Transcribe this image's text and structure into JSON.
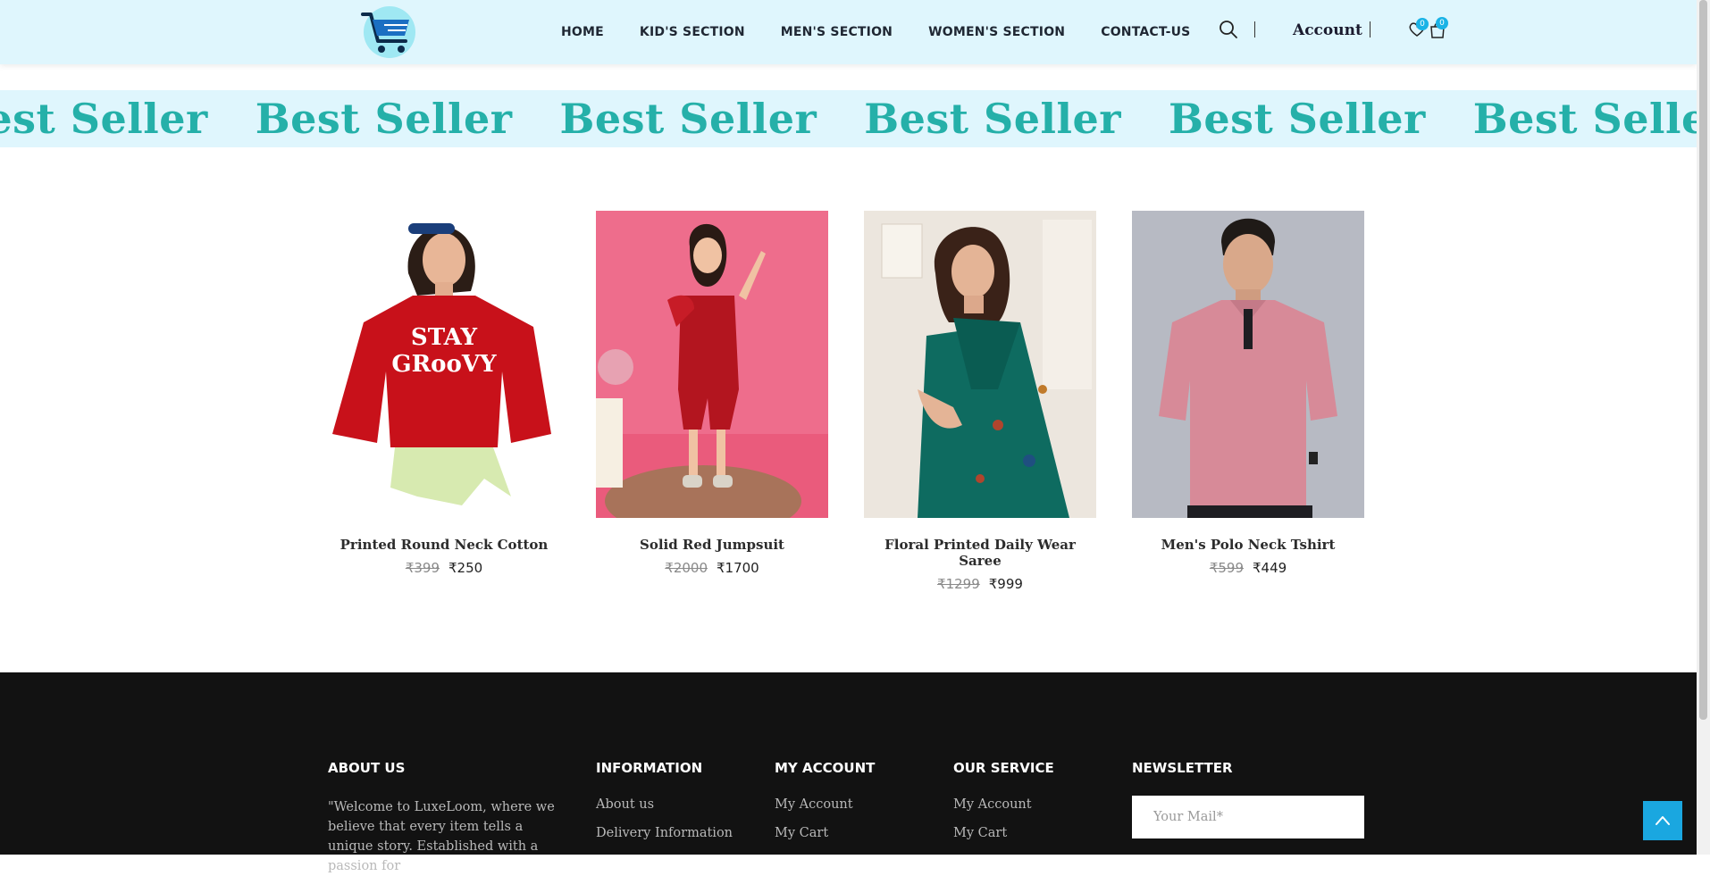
{
  "colors": {
    "header_bg": "#dff6fd",
    "marquee_text": "#25b0a9",
    "badge": "#1ab3e6",
    "footer_bg": "#121212",
    "scroll_top_button": "#1aa7e0"
  },
  "header": {
    "nav": [
      "HOME",
      "KID'S SECTION",
      "MEN'S SECTION",
      "WOMEN'S SECTION",
      "CONTACT-US"
    ],
    "account_label": "Account",
    "wishlist_count": "0",
    "cart_count": "0"
  },
  "marquee": {
    "text": "Best Seller"
  },
  "products": [
    {
      "name": "Printed Round Neck Cotton",
      "old_price": "₹399",
      "new_price": "₹250"
    },
    {
      "name": "Solid Red Jumpsuit",
      "old_price": "₹2000",
      "new_price": "₹1700"
    },
    {
      "name": "Floral Printed Daily Wear Saree",
      "old_price": "₹1299",
      "new_price": "₹999"
    },
    {
      "name": "Men's Polo Neck Tshirt",
      "old_price": "₹599",
      "new_price": "₹449"
    }
  ],
  "footer": {
    "about_heading": "ABOUT US",
    "about_text": "\"Welcome to LuxeLoom, where we believe that every item tells a unique story. Established with a passion for",
    "information_heading": "INFORMATION",
    "information_links": [
      "About us",
      "Delivery Information"
    ],
    "account_heading": "MY ACCOUNT",
    "account_links": [
      "My Account",
      "My Cart"
    ],
    "service_heading": "OUR SERVICE",
    "service_links": [
      "My Account",
      "My Cart"
    ],
    "newsletter_heading": "NEWSLETTER",
    "newsletter_placeholder": "Your Mail*"
  },
  "icons": [
    "cart-logo-icon",
    "search-icon",
    "heart-icon",
    "shopping-bag-icon",
    "arrow-up-icon"
  ]
}
